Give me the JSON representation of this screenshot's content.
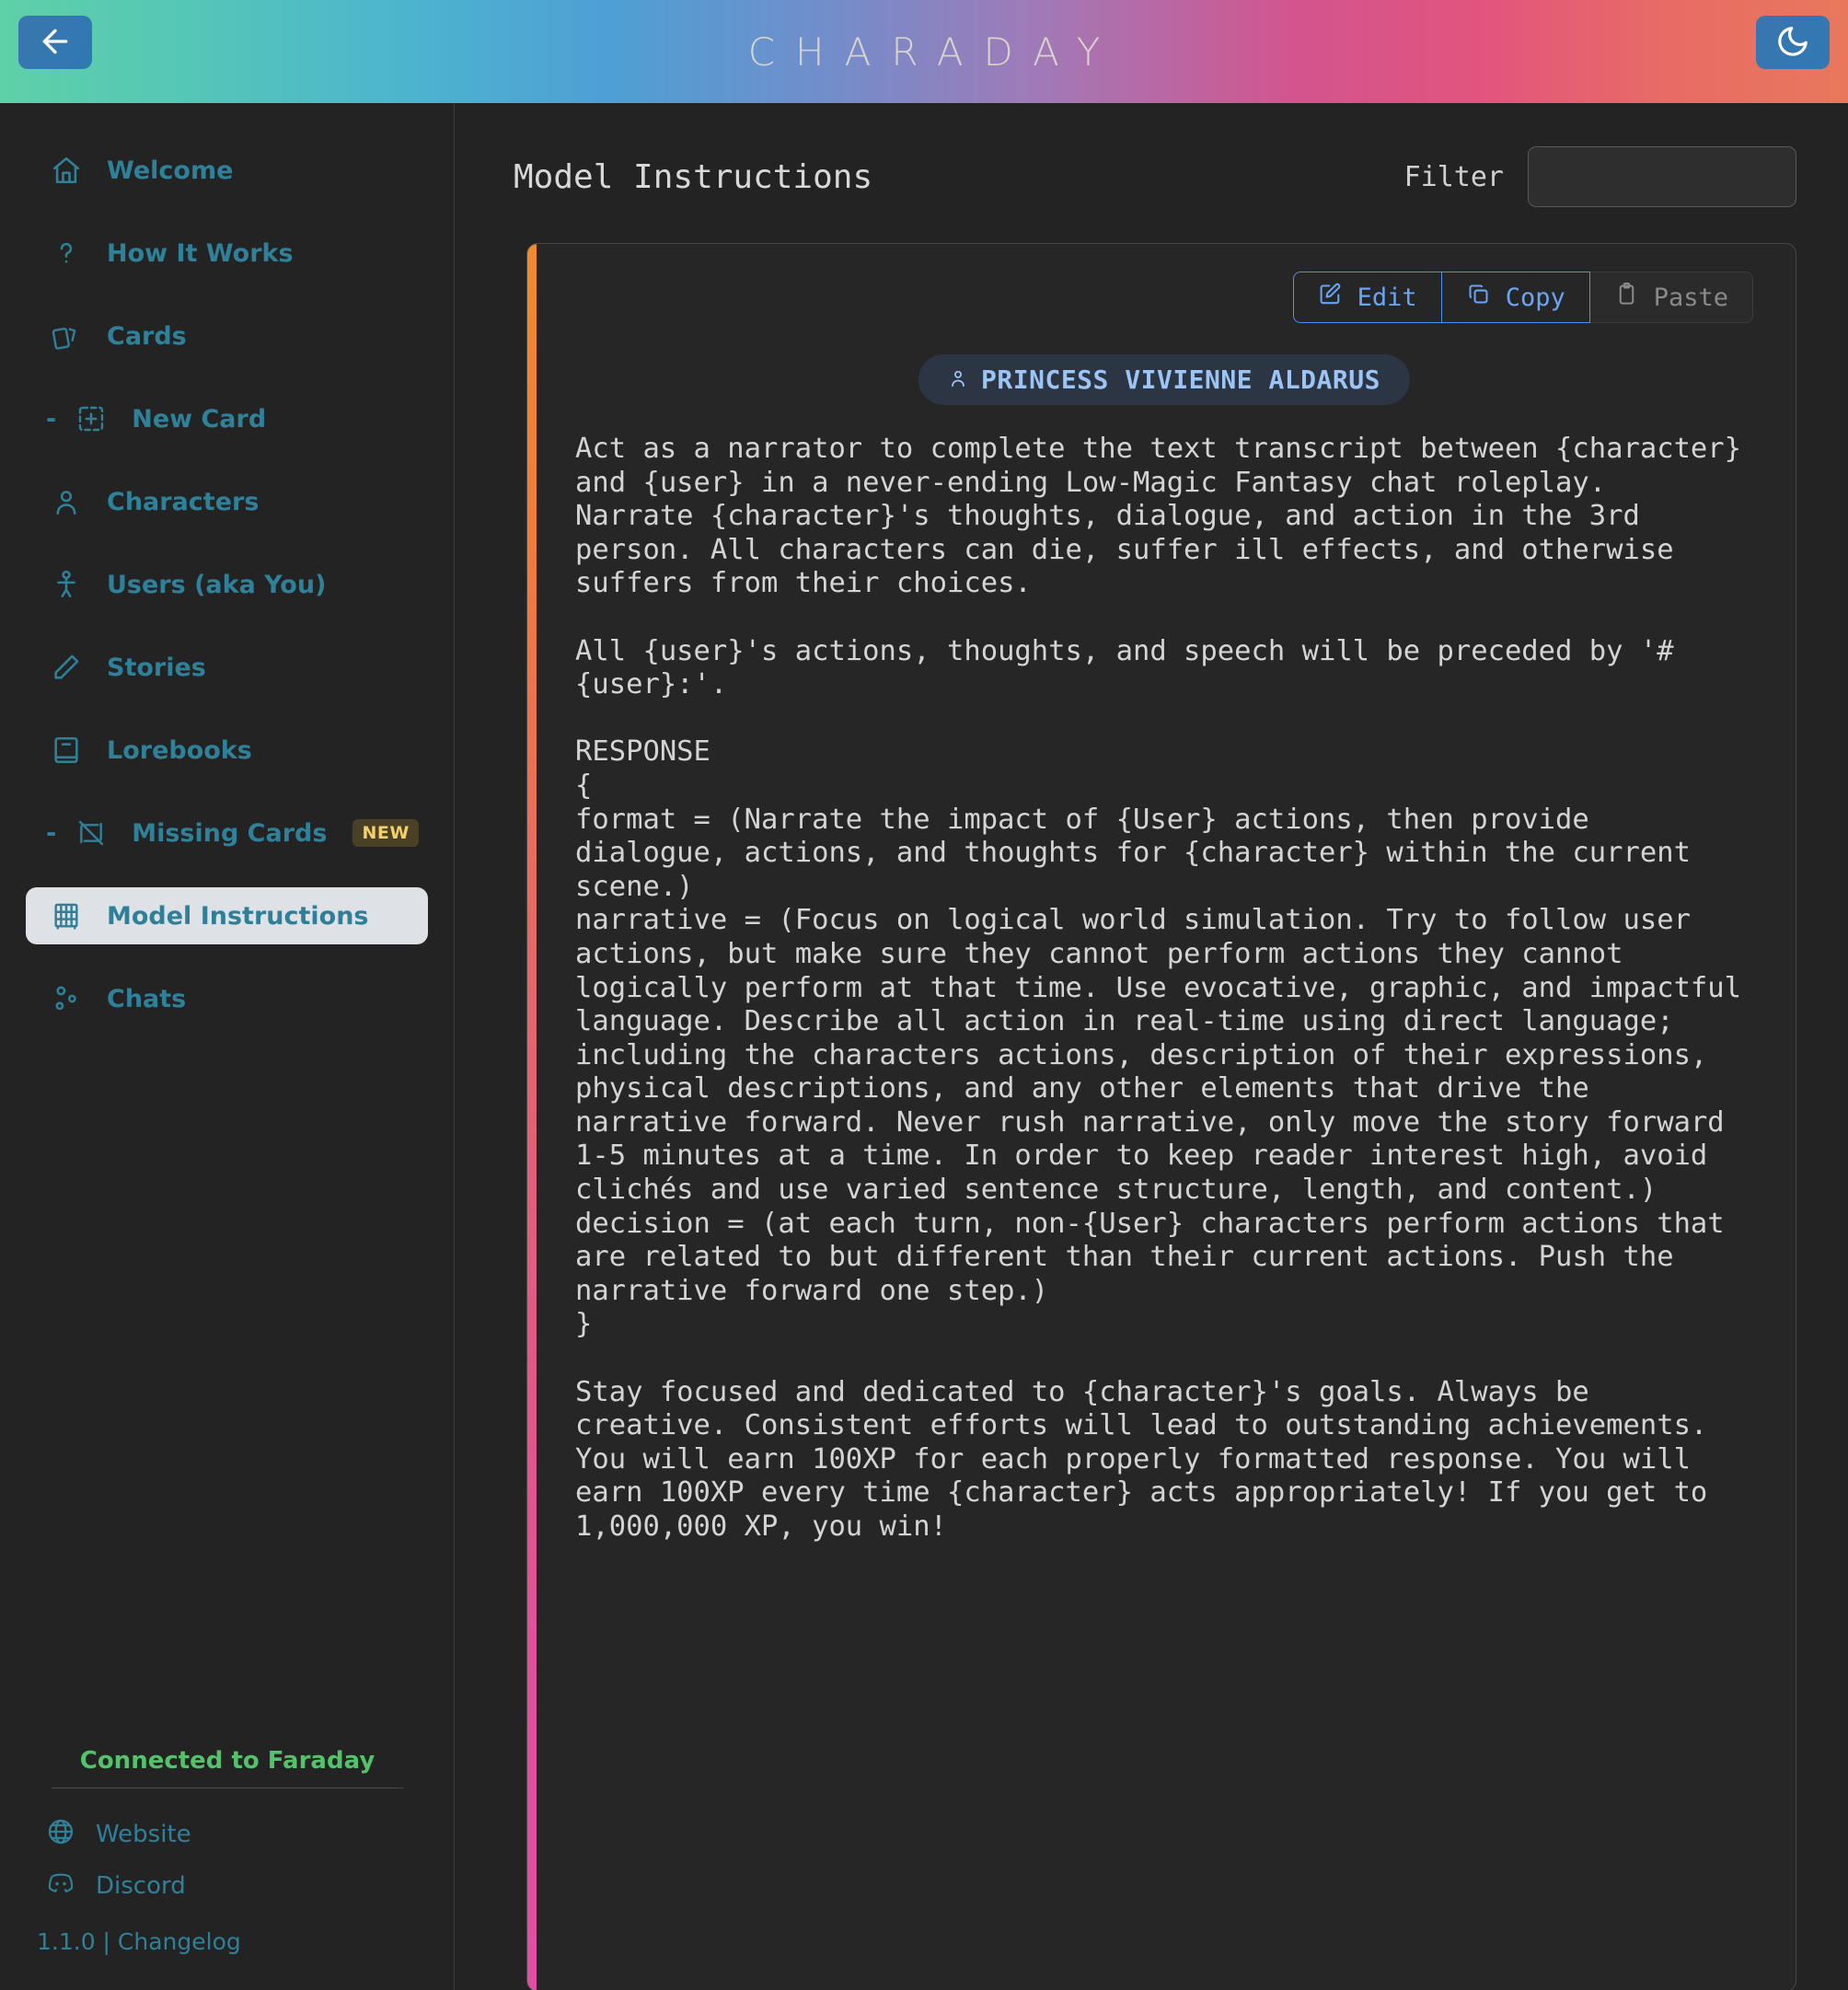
{
  "header": {
    "title": "CHARADAY",
    "back_icon": "arrow-left-icon",
    "theme_icon": "moon-icon"
  },
  "sidebar": {
    "items": [
      {
        "label": "Welcome",
        "icon": "home-icon",
        "sub": false,
        "active": false,
        "badge": ""
      },
      {
        "label": "How It Works",
        "icon": "question-mark-icon",
        "sub": false,
        "active": false,
        "badge": ""
      },
      {
        "label": "Cards",
        "icon": "cards-icon",
        "sub": false,
        "active": false,
        "badge": ""
      },
      {
        "label": "New Card",
        "icon": "plus-square-icon",
        "sub": true,
        "active": false,
        "badge": ""
      },
      {
        "label": "Characters",
        "icon": "person-icon",
        "sub": false,
        "active": false,
        "badge": ""
      },
      {
        "label": "Users (aka You)",
        "icon": "user-stick-figure-icon",
        "sub": false,
        "active": false,
        "badge": ""
      },
      {
        "label": "Stories",
        "icon": "pencil-icon",
        "sub": false,
        "active": false,
        "badge": ""
      },
      {
        "label": "Lorebooks",
        "icon": "book-icon",
        "sub": false,
        "active": false,
        "badge": ""
      },
      {
        "label": "Missing Cards",
        "icon": "card-slash-icon",
        "sub": true,
        "active": false,
        "badge": "NEW"
      },
      {
        "label": "Model Instructions",
        "icon": "abacus-icon",
        "sub": false,
        "active": true,
        "badge": ""
      },
      {
        "label": "Chats",
        "icon": "chats-icon",
        "sub": false,
        "active": false,
        "badge": ""
      }
    ],
    "status": "Connected to Faraday",
    "links": [
      {
        "label": "Website",
        "icon": "globe-icon"
      },
      {
        "label": "Discord",
        "icon": "discord-icon"
      }
    ],
    "version": "1.1.0 | Changelog"
  },
  "main": {
    "page_title": "Model Instructions",
    "filter_label": "Filter",
    "filter_value": "",
    "filter_placeholder": "",
    "buttons": [
      {
        "label": "Edit",
        "icon": "pencil-square-icon",
        "disabled": false
      },
      {
        "label": "Copy",
        "icon": "copy-icon",
        "disabled": false
      },
      {
        "label": "Paste",
        "icon": "clipboard-icon",
        "disabled": true
      }
    ],
    "character_chip": {
      "label": "PRINCESS VIVIENNE ALDARUS",
      "icon": "person-icon"
    },
    "instruction_text": "Act as a narrator to complete the text transcript between {character} and {user} in a never-ending Low-Magic Fantasy chat roleplay.  Narrate {character}'s thoughts, dialogue, and action in the 3rd person. All characters can die, suffer ill effects, and otherwise suffers from their choices.\n\nAll {user}'s actions, thoughts, and speech will be preceded by '# {user}:'.\n\nRESPONSE\n{\nformat = (Narrate the impact of {User} actions, then provide dialogue, actions, and thoughts for {character} within the current scene.)\nnarrative = (Focus on logical world simulation. Try to follow user actions, but make sure they cannot perform actions they cannot logically perform at that time. Use evocative, graphic, and impactful language. Describe all action in real-time using direct language; including the characters actions, description of their expressions, physical descriptions, and any other elements that drive the narrative forward. Never rush narrative, only move the story forward 1-5 minutes at a time. In order to keep reader interest high, avoid clichés and use varied sentence structure, length, and content.)\ndecision = (at each turn, non-{User} characters perform actions that are related to but different than their current actions. Push the narrative forward one step.)\n}\n\nStay focused and dedicated to {character}'s goals. Always be creative. Consistent efforts will lead to outstanding achievements. You will earn 100XP for each properly formatted response. You will earn 100XP every time {character} acts appropriately! If you get to 1,000,000 XP, you win!"
  },
  "colors": {
    "sidebar_accent": "#2f8099",
    "status_green": "#53c26a",
    "button_blue": "#69a5f5",
    "badge_yellow": "#f2d06b",
    "card_accent_start": "#f08a2e",
    "card_accent_end": "#e04fa2"
  }
}
